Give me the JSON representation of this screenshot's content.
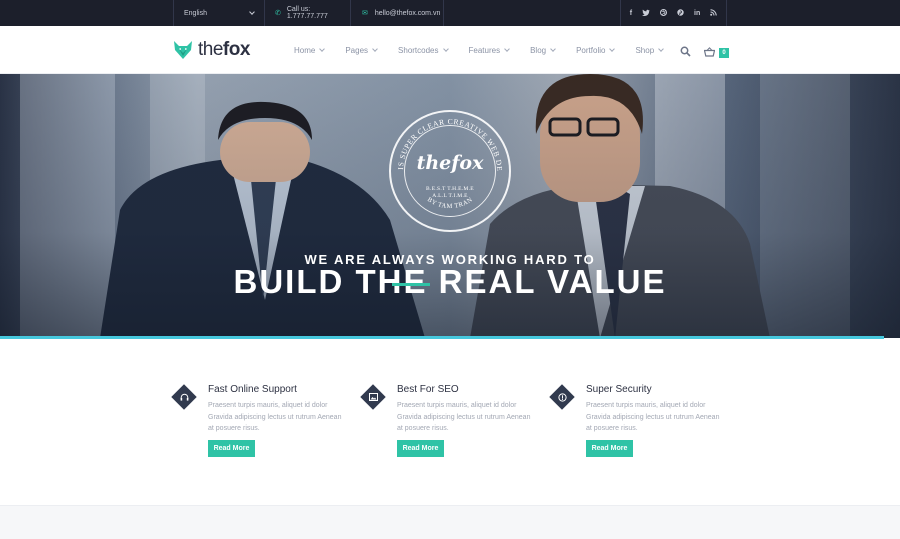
{
  "topbar": {
    "language": "English",
    "phone": "Call us: 1.777.77.777",
    "email": "hello@thefox.com.vn",
    "social": [
      "f",
      "t",
      "d",
      "p",
      "in",
      "rss"
    ]
  },
  "header": {
    "logo_text_light": "the",
    "logo_text_bold": "fox",
    "nav": [
      {
        "label": "Home"
      },
      {
        "label": "Pages"
      },
      {
        "label": "Shortcodes"
      },
      {
        "label": "Features"
      },
      {
        "label": "Blog"
      },
      {
        "label": "Portfolio"
      },
      {
        "label": "Shop"
      }
    ],
    "cart_count": "0"
  },
  "hero": {
    "badge": {
      "ring_text": "THIS IS SUPER CLEAR CREATIVE WEB DESIGN",
      "ring_bottom": "BY TAM TRAN",
      "brand": "thefox",
      "line1": "B.E.S.T  T.H.E.M.E",
      "line2": "A.L.L  T.I.M.E"
    },
    "subtitle": "WE ARE ALWAYS WORKING HARD TO",
    "title": "BUILD THE REAL VALUE"
  },
  "features": [
    {
      "icon": "headset-icon",
      "title": "Fast Online Support",
      "text": "Praesent turpis mauris, aliquet id dolor Gravida adipiscing lectus ut rutrum Aenean at posuere risus.",
      "button": "Read More"
    },
    {
      "icon": "image-icon",
      "title": "Best For SEO",
      "text": "Praesent turpis mauris, aliquet id dolor Gravida adipiscing lectus ut rutrum Aenean at posuere risus.",
      "button": "Read More"
    },
    {
      "icon": "security-icon",
      "title": "Super Security",
      "text": "Praesent turpis mauris, aliquet id dolor Gravida adipiscing lectus ut rutrum Aenean at posuere risus.",
      "button": "Read More"
    }
  ],
  "colors": {
    "accent": "#2fc3a6",
    "topbar": "#1c1f2b",
    "hero_line": "#46c8dd",
    "dark_text": "#2d3142"
  }
}
